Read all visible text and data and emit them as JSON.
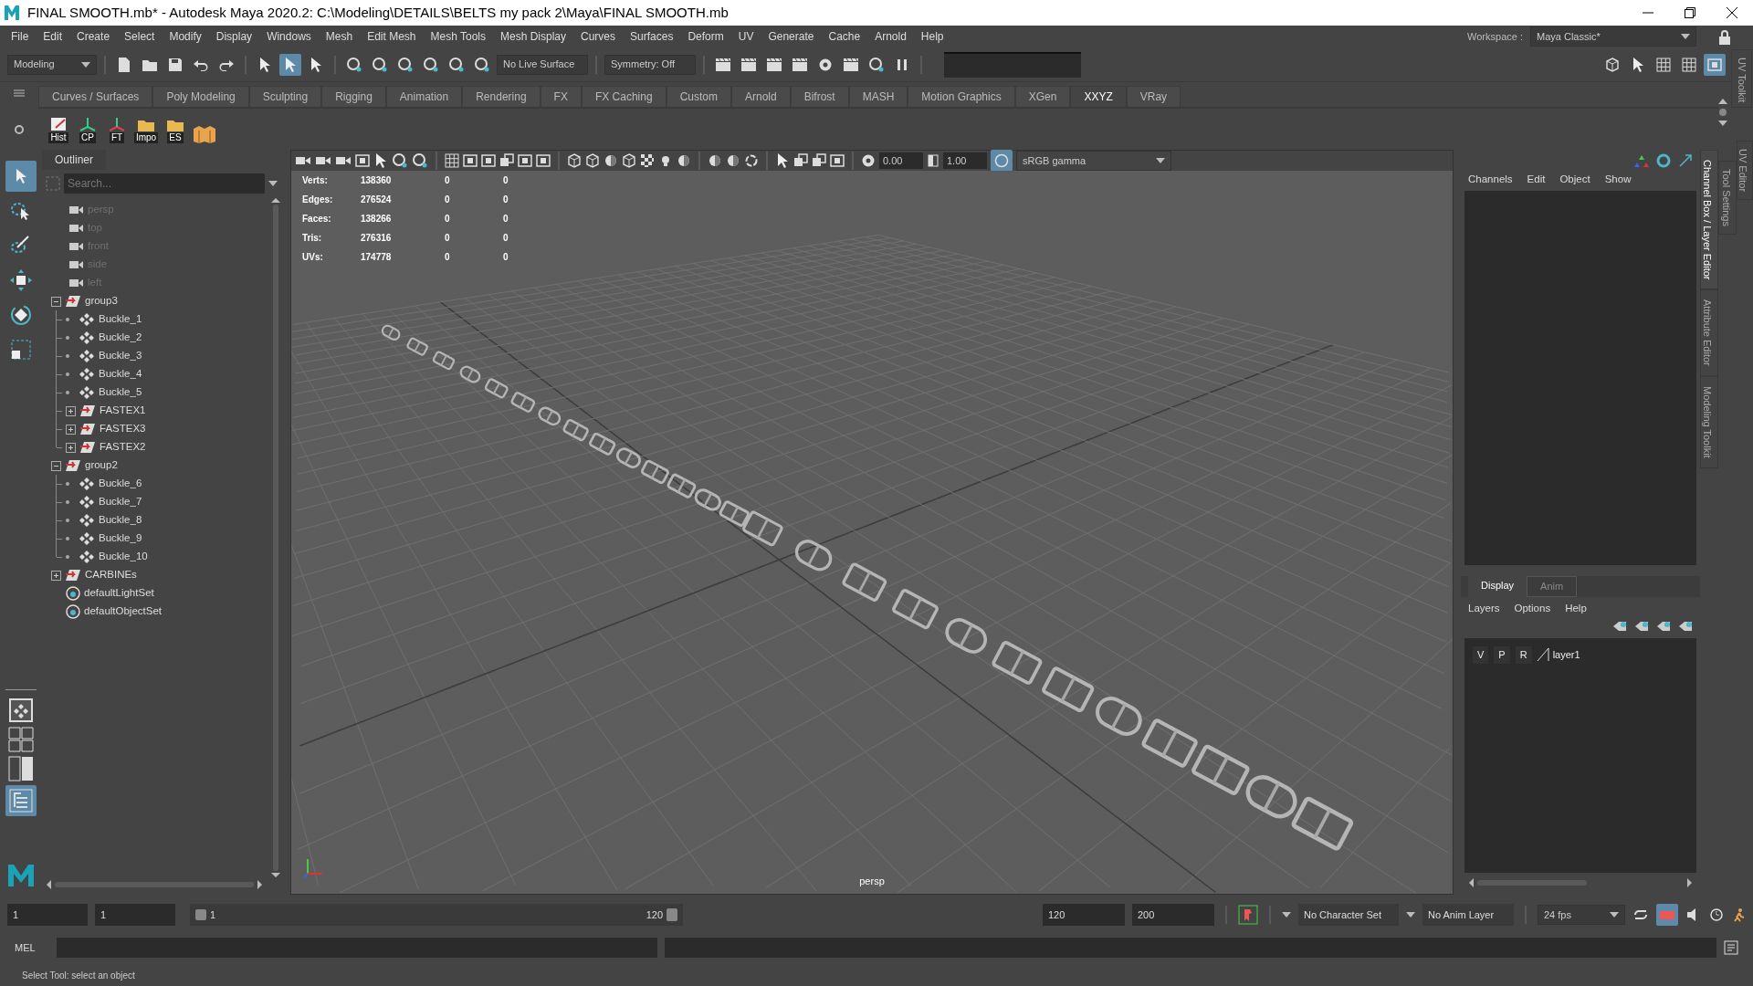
{
  "window": {
    "title": "FINAL SMOOTH.mb* - Autodesk Maya 2020.2: C:\\Modeling\\DETAILS\\BELTS my pack 2\\Maya\\FINAL SMOOTH.mb"
  },
  "menu_bar": [
    "File",
    "Edit",
    "Create",
    "Select",
    "Modify",
    "Display",
    "Windows",
    "Mesh",
    "Edit Mesh",
    "Mesh Tools",
    "Mesh Display",
    "Curves",
    "Surfaces",
    "Deform",
    "UV",
    "Generate",
    "Cache",
    "Arnold",
    "Help"
  ],
  "workspace": {
    "label": "Workspace :",
    "value": "Maya Classic*"
  },
  "status_line": {
    "menu_set": "Modeling",
    "selection_masks": [
      {
        "selected": false
      },
      {
        "selected": true
      },
      {
        "selected": false
      }
    ],
    "live_surface": "No Live Surface",
    "symmetry": "Symmetry: Off"
  },
  "shelf_tabs": [
    {
      "label": "Curves / Surfaces",
      "selected": false
    },
    {
      "label": "Poly Modeling",
      "selected": false
    },
    {
      "label": "Sculpting",
      "selected": false
    },
    {
      "label": "Rigging",
      "selected": false
    },
    {
      "label": "Animation",
      "selected": false
    },
    {
      "label": "Rendering",
      "selected": false
    },
    {
      "label": "FX",
      "selected": false
    },
    {
      "label": "FX Caching",
      "selected": false
    },
    {
      "label": "Custom",
      "selected": false
    },
    {
      "label": "Arnold",
      "selected": false
    },
    {
      "label": "Bifrost",
      "selected": false
    },
    {
      "label": "MASH",
      "selected": false
    },
    {
      "label": "Motion Graphics",
      "selected": false
    },
    {
      "label": "XGen",
      "selected": false
    },
    {
      "label": "XXYZ",
      "selected": true
    },
    {
      "label": "VRay",
      "selected": false
    }
  ],
  "shelf_buttons": [
    "Hist",
    "CP",
    "FT",
    "Impo",
    "ES"
  ],
  "side_tab": "UV Toolkit",
  "toolbox": [
    {
      "selected": true
    },
    {
      "selected": false
    },
    {
      "selected": false
    },
    {
      "selected": false
    },
    {
      "selected": false
    },
    {
      "selected": false
    }
  ],
  "outliner": {
    "title": "Outliner",
    "placeholder": "Search...",
    "items": [
      {
        "kind": "camera",
        "label": "persp",
        "dimmed": true
      },
      {
        "kind": "camera",
        "label": "top",
        "dimmed": true
      },
      {
        "kind": "camera",
        "label": "front",
        "dimmed": true
      },
      {
        "kind": "camera",
        "label": "side",
        "dimmed": true
      },
      {
        "kind": "camera",
        "label": "left",
        "dimmed": true
      },
      {
        "kind": "group",
        "label": "group3",
        "dimmed": false,
        "expanded": true,
        "children": [
          {
            "kind": "mesh",
            "label": "Buckle_1"
          },
          {
            "kind": "mesh",
            "label": "Buckle_2"
          },
          {
            "kind": "mesh",
            "label": "Buckle_3"
          },
          {
            "kind": "mesh",
            "label": "Buckle_4"
          },
          {
            "kind": "mesh",
            "label": "Buckle_5"
          },
          {
            "kind": "group",
            "label": "FASTEX1",
            "expanded": false
          },
          {
            "kind": "group",
            "label": "FASTEX3",
            "expanded": false
          },
          {
            "kind": "group",
            "label": "FASTEX2",
            "expanded": false
          }
        ]
      },
      {
        "kind": "group",
        "label": "group2",
        "dimmed": false,
        "expanded": true,
        "children": [
          {
            "kind": "mesh",
            "label": "Buckle_6"
          },
          {
            "kind": "mesh",
            "label": "Buckle_7"
          },
          {
            "kind": "mesh",
            "label": "Buckle_8"
          },
          {
            "kind": "mesh",
            "label": "Buckle_9"
          },
          {
            "kind": "mesh",
            "label": "Buckle_10"
          }
        ]
      },
      {
        "kind": "group",
        "label": "CARBINEs",
        "dimmed": false,
        "expanded": false
      },
      {
        "kind": "set",
        "label": "defaultLightSet",
        "dimmed": false
      },
      {
        "kind": "set",
        "label": "defaultObjectSet",
        "dimmed": false
      }
    ]
  },
  "viewport": {
    "exposure": "0.00",
    "gamma": "1.00",
    "color_space": "sRGB gamma",
    "camera": "persp",
    "stats": [
      {
        "label": "Verts:",
        "values": [
          "138360",
          "0",
          "0"
        ]
      },
      {
        "label": "Edges:",
        "values": [
          "276524",
          "0",
          "0"
        ]
      },
      {
        "label": "Faces:",
        "values": [
          "138266",
          "0",
          "0"
        ]
      },
      {
        "label": "Tris:",
        "values": [
          "276316",
          "0",
          "0"
        ]
      },
      {
        "label": "UVs:",
        "values": [
          "174778",
          "0",
          "0"
        ]
      }
    ]
  },
  "channel_box": {
    "menu": [
      "Channels",
      "Edit",
      "Object",
      "Show"
    ]
  },
  "layer_editor": {
    "tabs": [
      {
        "label": "Display",
        "selected": true
      },
      {
        "label": "Anim",
        "selected": false
      }
    ],
    "menu": [
      "Layers",
      "Options",
      "Help"
    ],
    "layers": [
      {
        "flags": [
          "V",
          "P",
          "R"
        ],
        "name": "layer1"
      }
    ]
  },
  "panel_tabs": [
    {
      "label": "Channel Box / Layer Editor",
      "selected": true
    },
    {
      "label": "Attribute Editor",
      "selected": false
    },
    {
      "label": "Modeling Toolkit",
      "selected": false
    }
  ],
  "outer_tabs": [
    "Tool Settings",
    "UV Editor"
  ],
  "time_slider": {
    "start": "1",
    "current": "1",
    "range": {
      "start": "1",
      "end": "120",
      "level": 1
    },
    "end": "120",
    "max": "200",
    "character_set": "No Character Set",
    "anim_layer": "No Anim Layer",
    "fps": "24 fps"
  },
  "command_line": {
    "language": "MEL"
  },
  "help_line": "Select Tool: select an object"
}
